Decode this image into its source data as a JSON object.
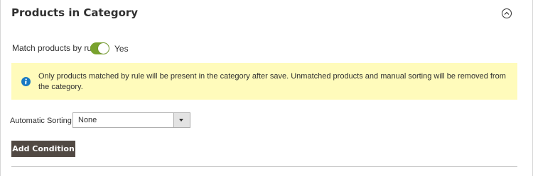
{
  "section": {
    "title": "Products in Category",
    "collapse_icon": "chevron-up-circle-icon"
  },
  "match_rule": {
    "label": "Match products by rule",
    "enabled": true,
    "state_text": "Yes",
    "accent_color": "#79a22e"
  },
  "notice": {
    "icon": "info-icon",
    "icon_color": "#1979c3",
    "background_color": "#fffbbb",
    "text": "Only products matched by rule will be present in the category after save. Unmatched products and manual sorting will be removed from the category."
  },
  "sorting": {
    "label": "Automatic Sorting",
    "selected_value": "None",
    "dropdown_icon": "triangle-down-icon"
  },
  "actions": {
    "add_condition_label": "Add Condition",
    "button_color": "#514943"
  }
}
